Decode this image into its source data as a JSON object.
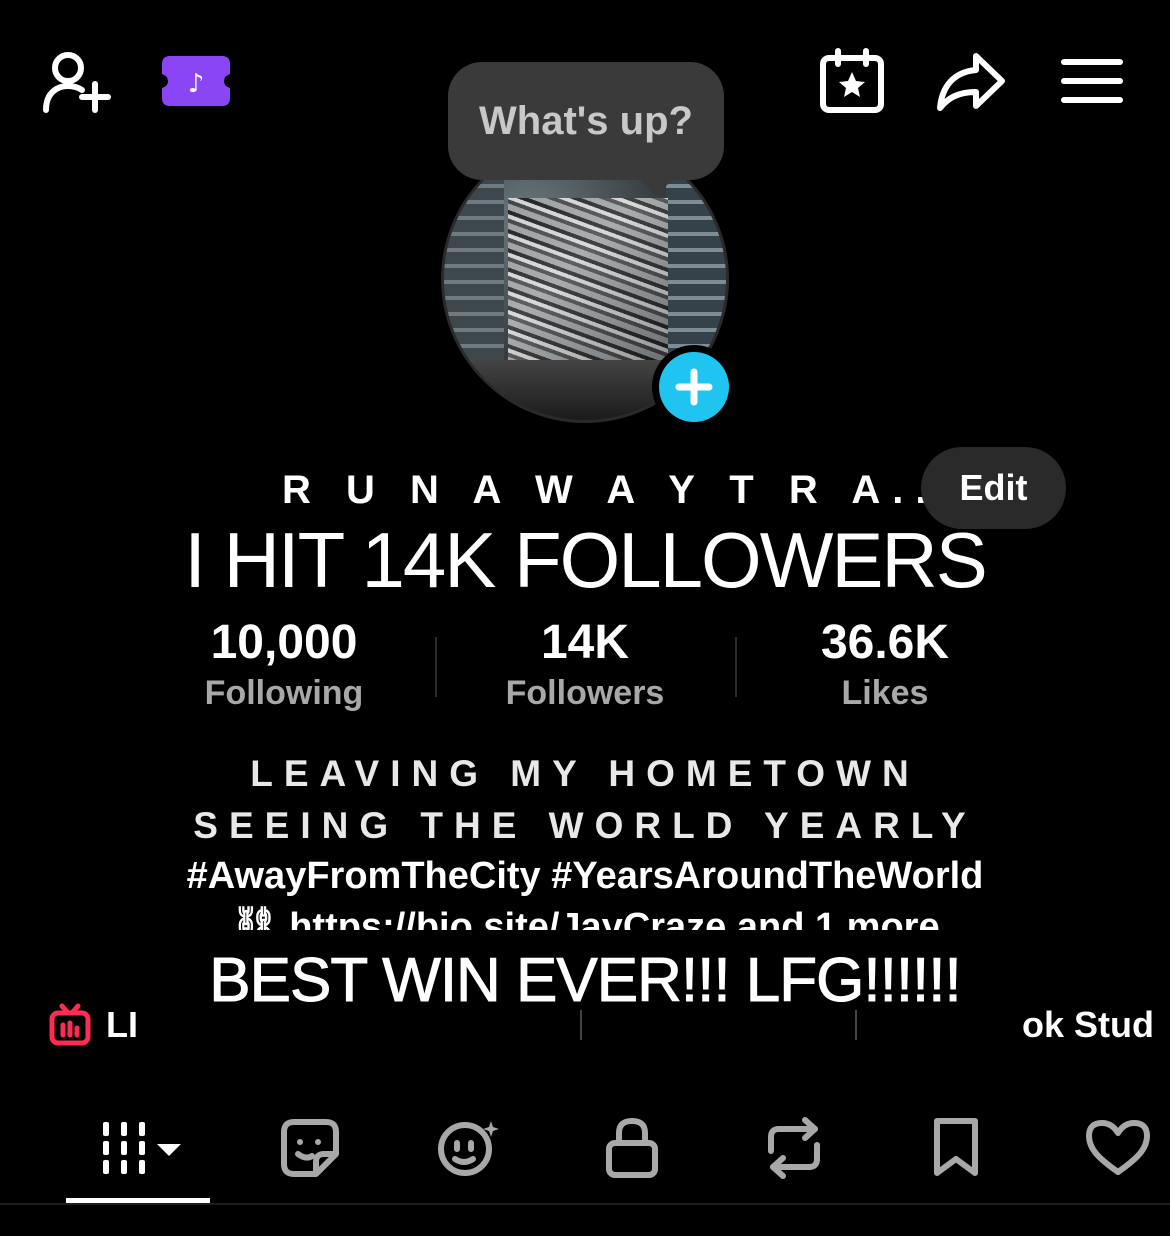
{
  "header": {
    "tooltip_text": "What's up?",
    "icons": [
      "add-friend-icon",
      "tiktok-ticket-icon",
      "calendar-star-icon",
      "share-icon",
      "menu-icon"
    ]
  },
  "profile": {
    "username": "R U N A W A Y  T R A...",
    "edit_label": "Edit",
    "avatar_sign": "JAY CRAZE"
  },
  "stats": {
    "following_count": "10,000",
    "following_label": "Following",
    "followers_count": "14K",
    "followers_label": "Followers",
    "likes_count": "36.6K",
    "likes_label": "Likes"
  },
  "bio": {
    "line1": "LEAVING MY HOMETOWN",
    "line2": "SEEING THE WORLD YEARLY",
    "tags": "#AwayFromTheCity #YearsAroundTheWorld",
    "link": "https://bio.site/JayCraze and 1 more"
  },
  "overlays": {
    "top_caption": "I HIT 14K FOLLOWERS",
    "bottom_caption": "BEST WIN EVER!!! LFG!!!!!!"
  },
  "shortcuts": [
    {
      "label": "LI",
      "icon": "live-tv-icon"
    },
    {
      "label": "ok Stud",
      "icon": "tiktok-studio-icon"
    }
  ],
  "tabs": [
    "videos-grid-icon",
    "stickers-icon",
    "ai-face-icon",
    "lock-icon",
    "repost-icon",
    "bookmark-icon",
    "heart-icon"
  ],
  "colors": {
    "background": "#000000",
    "accent_blue": "#20c4f0",
    "accent_purple": "#8a45f5",
    "accent_red": "#fe2c55"
  }
}
